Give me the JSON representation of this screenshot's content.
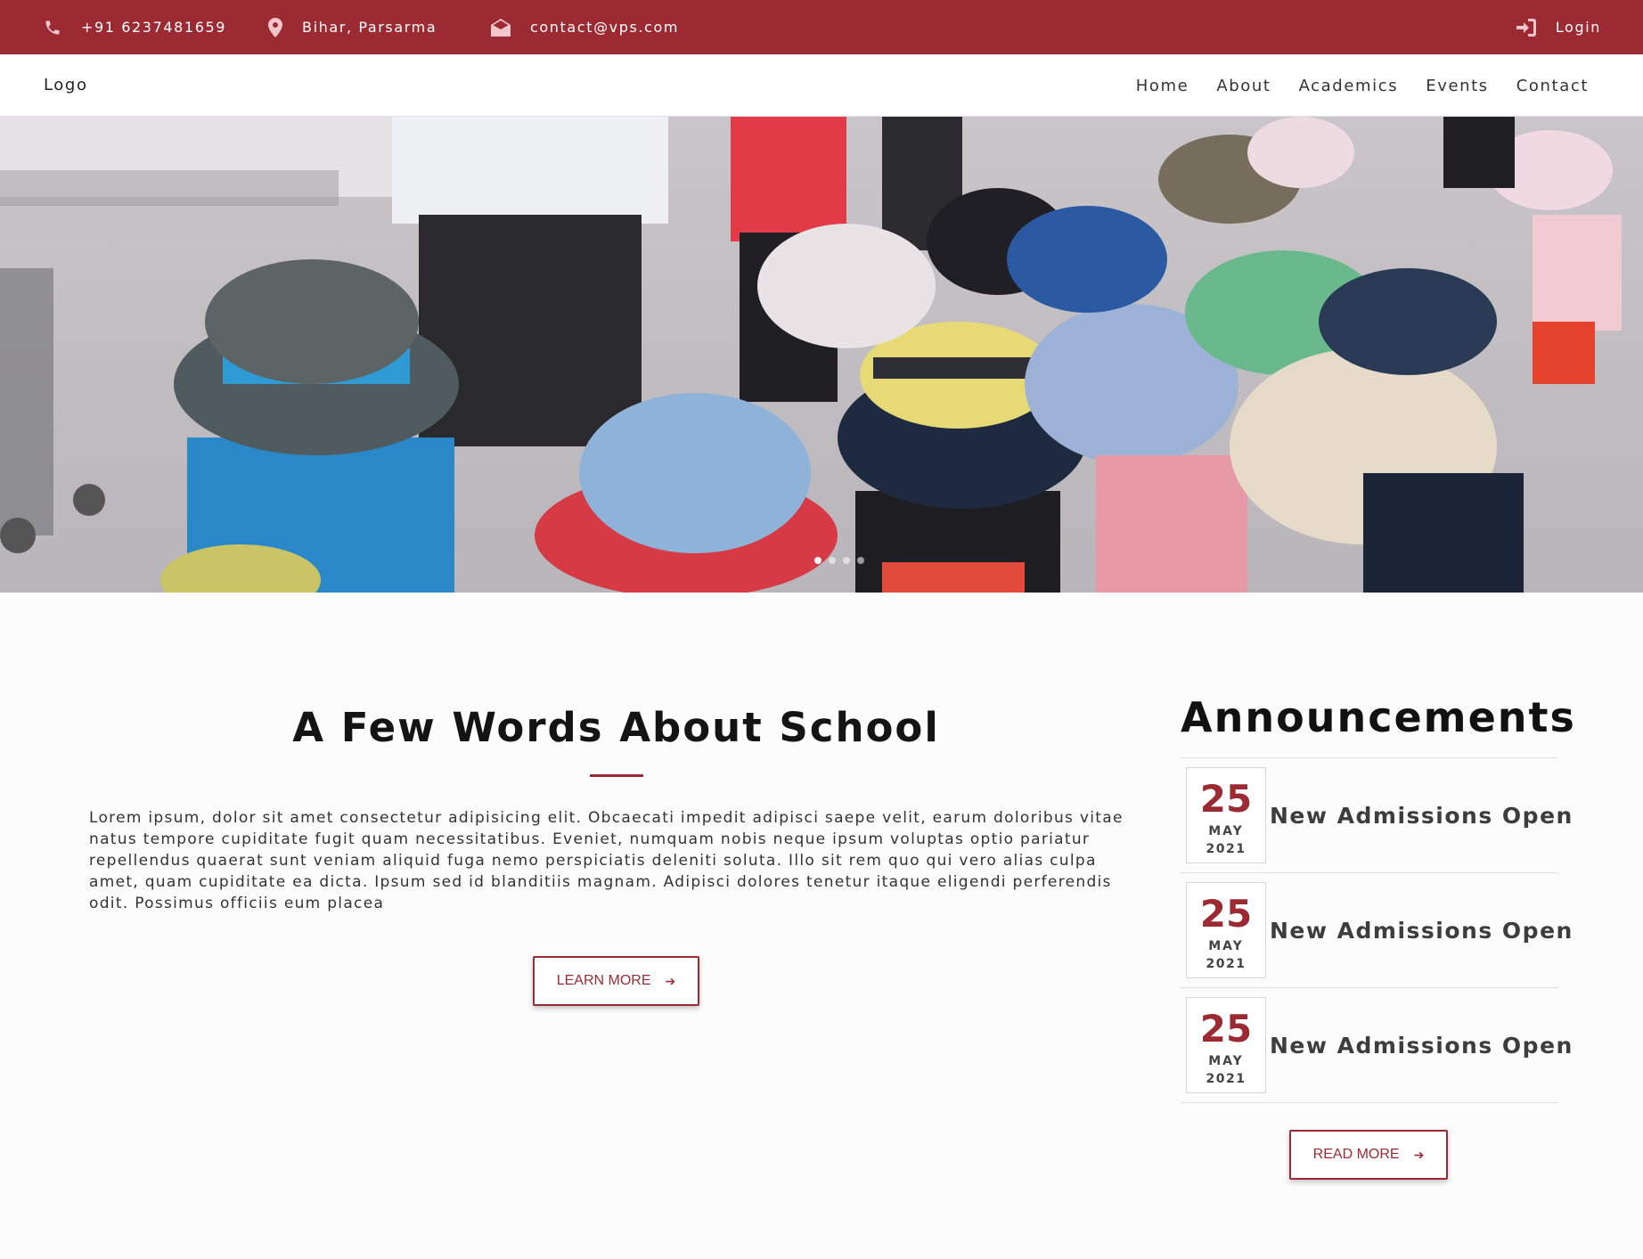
{
  "topbar": {
    "phone": "+91 6237481659",
    "location": "Bihar, Parsarma",
    "email": "contact@vps.com",
    "login": "Login"
  },
  "nav": {
    "logo": "Logo",
    "items": [
      "Home",
      "About",
      "Academics",
      "Events",
      "Contact"
    ]
  },
  "hero": {
    "slides_total": 4,
    "active_slide": 1
  },
  "about": {
    "title": "A Few Words About School",
    "text": "Lorem ipsum, dolor sit amet consectetur adipisicing elit. Obcaecati impedit adipisci saepe velit, earum doloribus vitae natus tempore cupiditate fugit quam necessitatibus. Eveniet, numquam nobis neque ipsum voluptas optio pariatur repellendus quaerat sunt veniam aliquid fuga nemo perspiciatis deleniti soluta. Illo sit rem quo qui vero alias culpa amet, quam cupiditate ea dicta. Ipsum sed id blanditiis magnam. Adipisci dolores tenetur itaque eligendi perferendis odit. Possimus officiis eum placea",
    "button": "LEARN MORE",
    "button_icon": "arrow-right-icon"
  },
  "announcements": {
    "title": "Announcements",
    "items": [
      {
        "day": "25",
        "month": "MAY",
        "year": "2021",
        "text": "New Admissions Open"
      },
      {
        "day": "25",
        "month": "MAY",
        "year": "2021",
        "text": "New Admissions Open"
      },
      {
        "day": "25",
        "month": "MAY",
        "year": "2021",
        "text": "New Admissions Open"
      }
    ],
    "button": "READ MORE",
    "button_icon": "arrow-right-icon"
  },
  "colors": {
    "brand": "#9b2a33",
    "background": "#fcfcfc"
  }
}
